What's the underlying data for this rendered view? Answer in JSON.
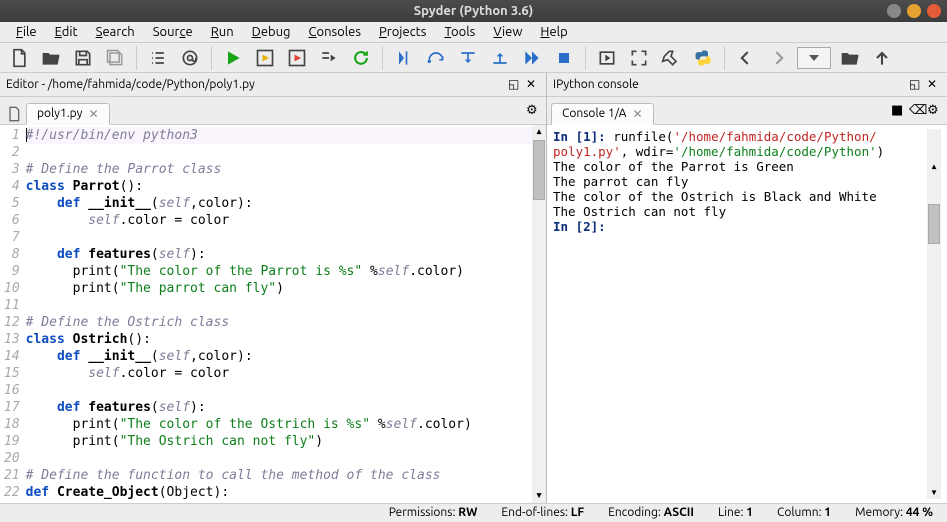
{
  "window_title": "Spyder (Python 3.6)",
  "menubar": [
    {
      "label": "File",
      "u": "F"
    },
    {
      "label": "Edit",
      "u": "E"
    },
    {
      "label": "Search",
      "u": "S"
    },
    {
      "label": "Source",
      "u": "c"
    },
    {
      "label": "Run",
      "u": "R"
    },
    {
      "label": "Debug",
      "u": "D"
    },
    {
      "label": "Consoles",
      "u": "C"
    },
    {
      "label": "Projects",
      "u": "P"
    },
    {
      "label": "Tools",
      "u": "T"
    },
    {
      "label": "View",
      "u": "V"
    },
    {
      "label": "Help",
      "u": "H"
    }
  ],
  "editor": {
    "pane_title": "Editor - /home/fahmida/code/Python/poly1.py",
    "tab_label": "poly1.py",
    "lines": [
      {
        "n": 1,
        "hl": true,
        "segs": [
          {
            "t": "caret"
          },
          {
            "c": "c-comment",
            "t": "#!/usr/bin/env python3"
          }
        ]
      },
      {
        "n": 2,
        "segs": []
      },
      {
        "n": 3,
        "segs": [
          {
            "c": "c-comment",
            "t": "# Define the Parrot class"
          }
        ]
      },
      {
        "n": 4,
        "segs": [
          {
            "c": "c-kw",
            "t": "class "
          },
          {
            "c": "c-cls",
            "t": "Parrot"
          },
          {
            "c": "c-norm",
            "t": "():"
          }
        ]
      },
      {
        "n": 5,
        "segs": [
          {
            "c": "c-norm",
            "t": "    "
          },
          {
            "c": "c-kw",
            "t": "def "
          },
          {
            "c": "c-def",
            "t": "__init__"
          },
          {
            "c": "c-norm",
            "t": "("
          },
          {
            "c": "c-self",
            "t": "self"
          },
          {
            "c": "c-norm",
            "t": ",color):"
          }
        ]
      },
      {
        "n": 6,
        "segs": [
          {
            "c": "c-norm",
            "t": "        "
          },
          {
            "c": "c-self",
            "t": "self"
          },
          {
            "c": "c-norm",
            "t": ".color = color"
          }
        ]
      },
      {
        "n": 7,
        "segs": []
      },
      {
        "n": 8,
        "segs": [
          {
            "c": "c-norm",
            "t": "    "
          },
          {
            "c": "c-kw",
            "t": "def "
          },
          {
            "c": "c-def",
            "t": "features"
          },
          {
            "c": "c-norm",
            "t": "("
          },
          {
            "c": "c-self",
            "t": "self"
          },
          {
            "c": "c-norm",
            "t": "):"
          }
        ]
      },
      {
        "n": 9,
        "segs": [
          {
            "c": "c-norm",
            "t": "      print("
          },
          {
            "c": "c-str",
            "t": "\"The color of the Parrot is %s\""
          },
          {
            "c": "c-norm",
            "t": " %"
          },
          {
            "c": "c-self",
            "t": "self"
          },
          {
            "c": "c-norm",
            "t": ".color)"
          }
        ]
      },
      {
        "n": 10,
        "segs": [
          {
            "c": "c-norm",
            "t": "      print("
          },
          {
            "c": "c-str",
            "t": "\"The parrot can fly\""
          },
          {
            "c": "c-norm",
            "t": ")"
          }
        ]
      },
      {
        "n": 11,
        "segs": []
      },
      {
        "n": 12,
        "segs": [
          {
            "c": "c-comment",
            "t": "# Define the Ostrich class"
          }
        ]
      },
      {
        "n": 13,
        "segs": [
          {
            "c": "c-kw",
            "t": "class "
          },
          {
            "c": "c-cls",
            "t": "Ostrich"
          },
          {
            "c": "c-norm",
            "t": "():"
          }
        ]
      },
      {
        "n": 14,
        "segs": [
          {
            "c": "c-norm",
            "t": "    "
          },
          {
            "c": "c-kw",
            "t": "def "
          },
          {
            "c": "c-def",
            "t": "__init__"
          },
          {
            "c": "c-norm",
            "t": "("
          },
          {
            "c": "c-self",
            "t": "self"
          },
          {
            "c": "c-norm",
            "t": ",color):"
          }
        ]
      },
      {
        "n": 15,
        "segs": [
          {
            "c": "c-norm",
            "t": "        "
          },
          {
            "c": "c-self",
            "t": "self"
          },
          {
            "c": "c-norm",
            "t": ".color = color"
          }
        ]
      },
      {
        "n": 16,
        "segs": []
      },
      {
        "n": 17,
        "segs": [
          {
            "c": "c-norm",
            "t": "    "
          },
          {
            "c": "c-kw",
            "t": "def "
          },
          {
            "c": "c-def",
            "t": "features"
          },
          {
            "c": "c-norm",
            "t": "("
          },
          {
            "c": "c-self",
            "t": "self"
          },
          {
            "c": "c-norm",
            "t": "):"
          }
        ]
      },
      {
        "n": 18,
        "segs": [
          {
            "c": "c-norm",
            "t": "      print("
          },
          {
            "c": "c-str",
            "t": "\"The color of the Ostrich is %s\""
          },
          {
            "c": "c-norm",
            "t": " %"
          },
          {
            "c": "c-self",
            "t": "self"
          },
          {
            "c": "c-norm",
            "t": ".color)"
          }
        ]
      },
      {
        "n": 19,
        "segs": [
          {
            "c": "c-norm",
            "t": "      print("
          },
          {
            "c": "c-str",
            "t": "\"The Ostrich can not fly\""
          },
          {
            "c": "c-norm",
            "t": ")"
          }
        ]
      },
      {
        "n": 20,
        "segs": []
      },
      {
        "n": 21,
        "segs": [
          {
            "c": "c-comment",
            "t": "# Define the function to call the method of the class"
          }
        ]
      },
      {
        "n": 22,
        "segs": [
          {
            "c": "c-kw",
            "t": "def "
          },
          {
            "c": "c-def",
            "t": "Create_Object"
          },
          {
            "c": "c-norm",
            "t": "(Object):"
          }
        ]
      }
    ]
  },
  "console": {
    "pane_title": "IPython console",
    "tab_label": "Console 1/A",
    "lines": [
      [
        {
          "c": "con-prompt",
          "t": "In [1]: "
        },
        {
          "t": "runfile("
        },
        {
          "c": "con-path",
          "t": "'/home/fahmida/code/Python/"
        }
      ],
      [
        {
          "c": "con-path",
          "t": "poly1.py'"
        },
        {
          "t": ", wdir="
        },
        {
          "c": "con-green",
          "t": "'/home/fahmida/code/Python'"
        },
        {
          "t": ")"
        }
      ],
      [
        {
          "t": "The color of the Parrot is Green"
        }
      ],
      [
        {
          "t": "The parrot can fly"
        }
      ],
      [
        {
          "t": "The color of the Ostrich is Black and White"
        }
      ],
      [
        {
          "t": "The Ostrich can not fly"
        }
      ],
      [
        {
          "t": ""
        }
      ],
      [
        {
          "c": "con-prompt",
          "t": "In [2]: "
        }
      ]
    ]
  },
  "statusbar": {
    "permissions_label": "Permissions:",
    "permissions": "RW",
    "eol_label": "End-of-lines:",
    "eol": "LF",
    "encoding_label": "Encoding:",
    "encoding": "ASCII",
    "line_label": "Line:",
    "line": "1",
    "col_label": "Column:",
    "col": "1",
    "mem_label": "Memory:",
    "mem": "44 %"
  }
}
